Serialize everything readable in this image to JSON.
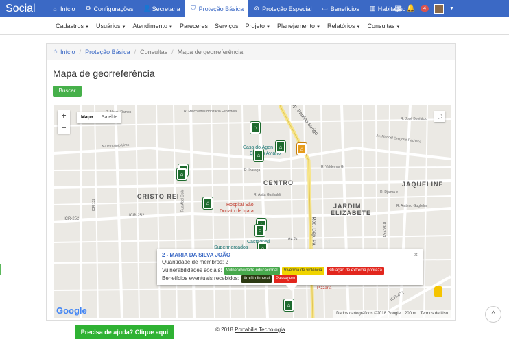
{
  "app": {
    "brand": "Social"
  },
  "topnav": {
    "items": [
      {
        "label": "Início",
        "icon": "home-icon"
      },
      {
        "label": "Configurações",
        "icon": "gear-icon"
      },
      {
        "label": "Secretaria",
        "icon": "person-icon"
      },
      {
        "label": "Proteção Básica",
        "icon": "shield-icon",
        "active": true
      },
      {
        "label": "Proteção Especial",
        "icon": "shield-slash-icon"
      },
      {
        "label": "Benefícios",
        "icon": "gift-icon"
      },
      {
        "label": "Habitação",
        "icon": "building-icon"
      }
    ],
    "notifications": "4"
  },
  "subnav": {
    "items": [
      {
        "label": "Cadastros",
        "dropdown": true
      },
      {
        "label": "Usuários",
        "dropdown": true
      },
      {
        "label": "Atendimento",
        "dropdown": true
      },
      {
        "label": "Pareceres",
        "dropdown": false
      },
      {
        "label": "Serviços",
        "dropdown": false
      },
      {
        "label": "Projeto",
        "dropdown": true
      },
      {
        "label": "Planejamento",
        "dropdown": true
      },
      {
        "label": "Relatórios",
        "dropdown": true
      },
      {
        "label": "Consultas",
        "dropdown": true
      }
    ]
  },
  "breadcrumb": {
    "home": "Início",
    "section": "Proteção Básica",
    "sub": "Consultas",
    "current": "Mapa de georreferência"
  },
  "page": {
    "title": "Mapa de georreferência",
    "search_button": "Buscar"
  },
  "map": {
    "type_map": "Mapa",
    "type_satellite": "Satélite",
    "zoom_in": "+",
    "zoom_out": "−",
    "logo": "Google",
    "attribution": "Dados cartográficos ©2018 Google",
    "scale": "200 m",
    "terms": "Termos de Uso",
    "streets": {
      "s1": "R. Melchiades Bonifácio Espindola",
      "s2": "R. Nereu Ramos",
      "s3": "Av. Procópio Lima",
      "s4": "Av. Manoel Gregório Pacheco",
      "s5": "R. José Bonifácio",
      "s6": "R. Iparaga",
      "s7": "R. Valdemar G.",
      "s8": "R. Djalma e",
      "s9": "R. Antônio Guglielmi",
      "s10": "ICR-252",
      "s11": "ICR-252",
      "s12": "Rod. Dep. Paulino Burigo",
      "s13": "Rod. Dep. Pa",
      "s14": "R. Anita Garibaldi",
      "s15": "ICR-253",
      "s16": "ICR-471",
      "s17": "Av. Ju",
      "s18": "Rua Abel Colle",
      "s19": "ICR 132"
    },
    "areas": {
      "centro": "CENTRO",
      "jaqueline": "JAQUELINE",
      "cristo": "CRISTO REI",
      "jardim": "JARDIM",
      "elizabete": "ELIZABETE"
    },
    "pois": {
      "hospital": "Hospital São",
      "hospital2": "Donato de Içara",
      "casa": "Casa do Agen",
      "casa2": "Caritas Aviário",
      "castagneti": "Castagneti",
      "supermercados": "Supermercados",
      "pizzaria": "Pizzaria"
    },
    "markers": [
      {
        "icon": "family-marker-icon"
      },
      {
        "icon": "family-marker-icon"
      },
      {
        "icon": "family-marker-icon"
      },
      {
        "icon": "family-marker-icon"
      },
      {
        "icon": "family-marker-icon"
      },
      {
        "icon": "family-marker-icon"
      },
      {
        "icon": "family-marker-icon"
      },
      {
        "icon": "family-marker-icon"
      },
      {
        "icon": "family-marker-icon"
      },
      {
        "icon": "family-marker-icon"
      },
      {
        "icon": "office-marker-icon"
      }
    ],
    "info": {
      "name": "2 - MARIA DA SILVA JOÃO",
      "members": "Quantidade de membros: 2",
      "vuln_label": "Vulnerabilidades sociais:",
      "vulnerabilities": [
        "Vulnerabilidade educacional",
        "Vivência de violência",
        "Situação de extrema pobreza"
      ],
      "benefits_label": "Benefícios eventuais recebidos:",
      "benefits": [
        "Auxílio funeral",
        "Passagem"
      ],
      "close": "×"
    }
  },
  "footer": {
    "help": "Precisa de ajuda? Clique aqui",
    "copyright": "© 2018",
    "company": "Portabilis Tecnologia",
    "period": ".",
    "scroll_top": "^"
  },
  "colors": {
    "nav": "#3b69c5",
    "success": "#46b04a",
    "marker": "#1e6b2e"
  }
}
